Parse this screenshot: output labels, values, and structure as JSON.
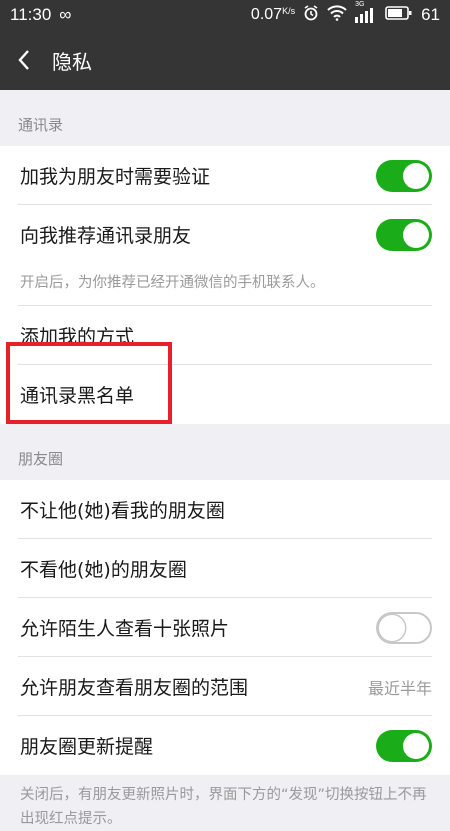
{
  "status_bar": {
    "time": "11:30",
    "speed": "0.07",
    "speed_unit": "K/s",
    "network": "3G",
    "battery": "61"
  },
  "header": {
    "back_icon": "chevron-left-icon",
    "title": "隐私"
  },
  "contacts_section": {
    "header": "通讯录",
    "verify_label": "加我为朋友时需要验证",
    "verify_on": true,
    "recommend_label": "向我推荐通讯录朋友",
    "recommend_on": true,
    "recommend_note": "开启后，为你推荐已经开通微信的手机联系人。",
    "add_methods_label": "添加我的方式",
    "blacklist_label": "通讯录黑名单"
  },
  "moments_section": {
    "header": "朋友圈",
    "hide_mine_label": "不让他(她)看我的朋友圈",
    "hide_theirs_label": "不看他(她)的朋友圈",
    "stranger_photos_label": "允许陌生人查看十张照片",
    "stranger_photos_on": false,
    "range_label": "允许朋友查看朋友圈的范围",
    "range_value": "最近半年",
    "update_notify_label": "朋友圈更新提醒",
    "update_notify_on": true,
    "update_notify_note": "关闭后，有朋友更新照片时，界面下方的“发现”切换按钮上不再出现红点提示。"
  },
  "colors": {
    "toolbar": "#353535",
    "toggle_on": "#1aad19",
    "highlight": "#e8202a",
    "background": "#efeff4"
  }
}
